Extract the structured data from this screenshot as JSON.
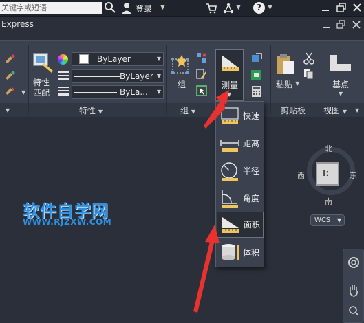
{
  "topbar": {
    "search_placeholder": "关键字或短语",
    "login_label": "登录"
  },
  "menubar": {
    "express_label": "Express"
  },
  "ribbon": {
    "match_props_label": "特性\n匹配",
    "color_combo": "ByLayer",
    "linetype_combo": "ByLayer",
    "lineweight_combo": "ByLa...",
    "group_button_label": "组",
    "measure_button_label": "测量",
    "paste_button_label": "粘贴",
    "base_button_label": "基点",
    "panel_labels": {
      "properties": "特性",
      "group": "组",
      "clipboard": "剪贴板",
      "view": "视图"
    }
  },
  "measure_menu": {
    "items": [
      {
        "label": "快速",
        "icon": "quick-measure-icon"
      },
      {
        "label": "距离",
        "icon": "distance-icon"
      },
      {
        "label": "半径",
        "icon": "radius-icon"
      },
      {
        "label": "角度",
        "icon": "angle-icon"
      },
      {
        "label": "面积",
        "icon": "area-icon",
        "highlighted": true
      },
      {
        "label": "体积",
        "icon": "volume-icon"
      }
    ]
  },
  "viewcube": {
    "north": "北",
    "south": "南",
    "east": "东",
    "west": "西",
    "wcs_label": "WCS"
  },
  "watermark": {
    "title": "软件自学网",
    "url": "WWW.RJZXW.COM"
  },
  "colors": {
    "arrow_red": "#e8322f",
    "watermark_blue": "#2f8fe0",
    "ribbon_bg": "#3b414f",
    "canvas_bg": "#2b2f39"
  }
}
